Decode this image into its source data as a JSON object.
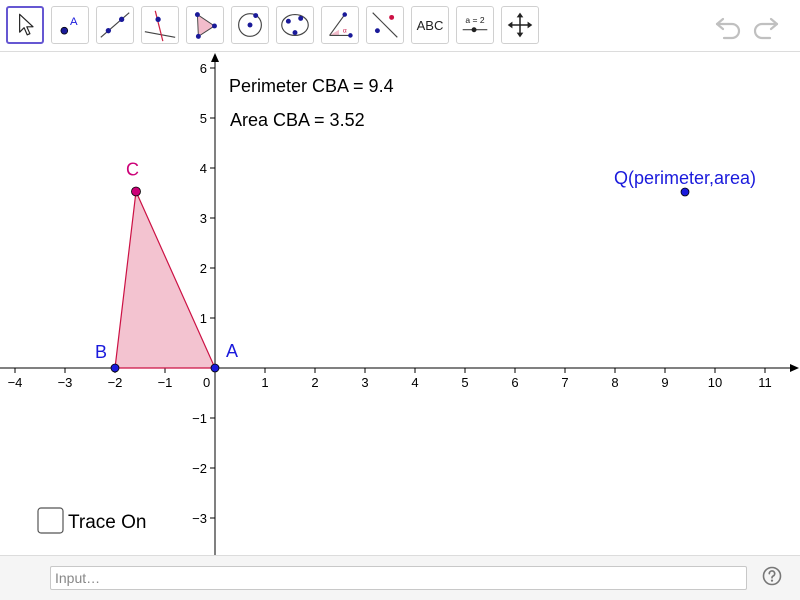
{
  "toolbar": {
    "tools": [
      {
        "name": "move-tool"
      },
      {
        "name": "point-tool",
        "glyph": "A"
      },
      {
        "name": "line-tool"
      },
      {
        "name": "perpendicular-line-tool"
      },
      {
        "name": "polygon-tool"
      },
      {
        "name": "circle-tool"
      },
      {
        "name": "conic-tool"
      },
      {
        "name": "angle-tool",
        "glyph": "α"
      },
      {
        "name": "reflect-tool"
      },
      {
        "name": "text-tool",
        "label": "ABC"
      },
      {
        "name": "slider-tool",
        "label": "a = 2"
      },
      {
        "name": "move-graphics-view-tool"
      }
    ],
    "undo_icon": "undo-icon",
    "redo_icon": "redo-icon"
  },
  "graphics": {
    "x_ticks": [
      "−4",
      "−3",
      "−2",
      "−1",
      "0",
      "1",
      "2",
      "3",
      "4",
      "5",
      "6",
      "7",
      "8",
      "9",
      "10",
      "11"
    ],
    "y_ticks": [
      "−3",
      "−2",
      "−1",
      "1",
      "2",
      "3",
      "4",
      "5",
      "6"
    ],
    "perimeter_text": "Perimeter CBA = 9.4",
    "area_text": "Area CBA = 3.52",
    "points": {
      "A": {
        "label": "A",
        "x": 0,
        "y": 0,
        "color": "#1a1adc"
      },
      "B": {
        "label": "B",
        "x": -2,
        "y": 0,
        "color": "#1a1adc"
      },
      "C": {
        "label": "C",
        "x": -1.58,
        "y": 3.53,
        "color": "#cc0077"
      },
      "Q": {
        "label": "Q(perimeter,area)",
        "x": 9.4,
        "y": 3.52,
        "color": "#1a1adc"
      }
    },
    "triangle": {
      "fill": "#f2bccb",
      "stroke": "#cc1144"
    },
    "checkbox": {
      "label": "Trace On",
      "checked": false
    }
  },
  "inputbar": {
    "placeholder": "Input…",
    "help_icon": "help-icon"
  }
}
